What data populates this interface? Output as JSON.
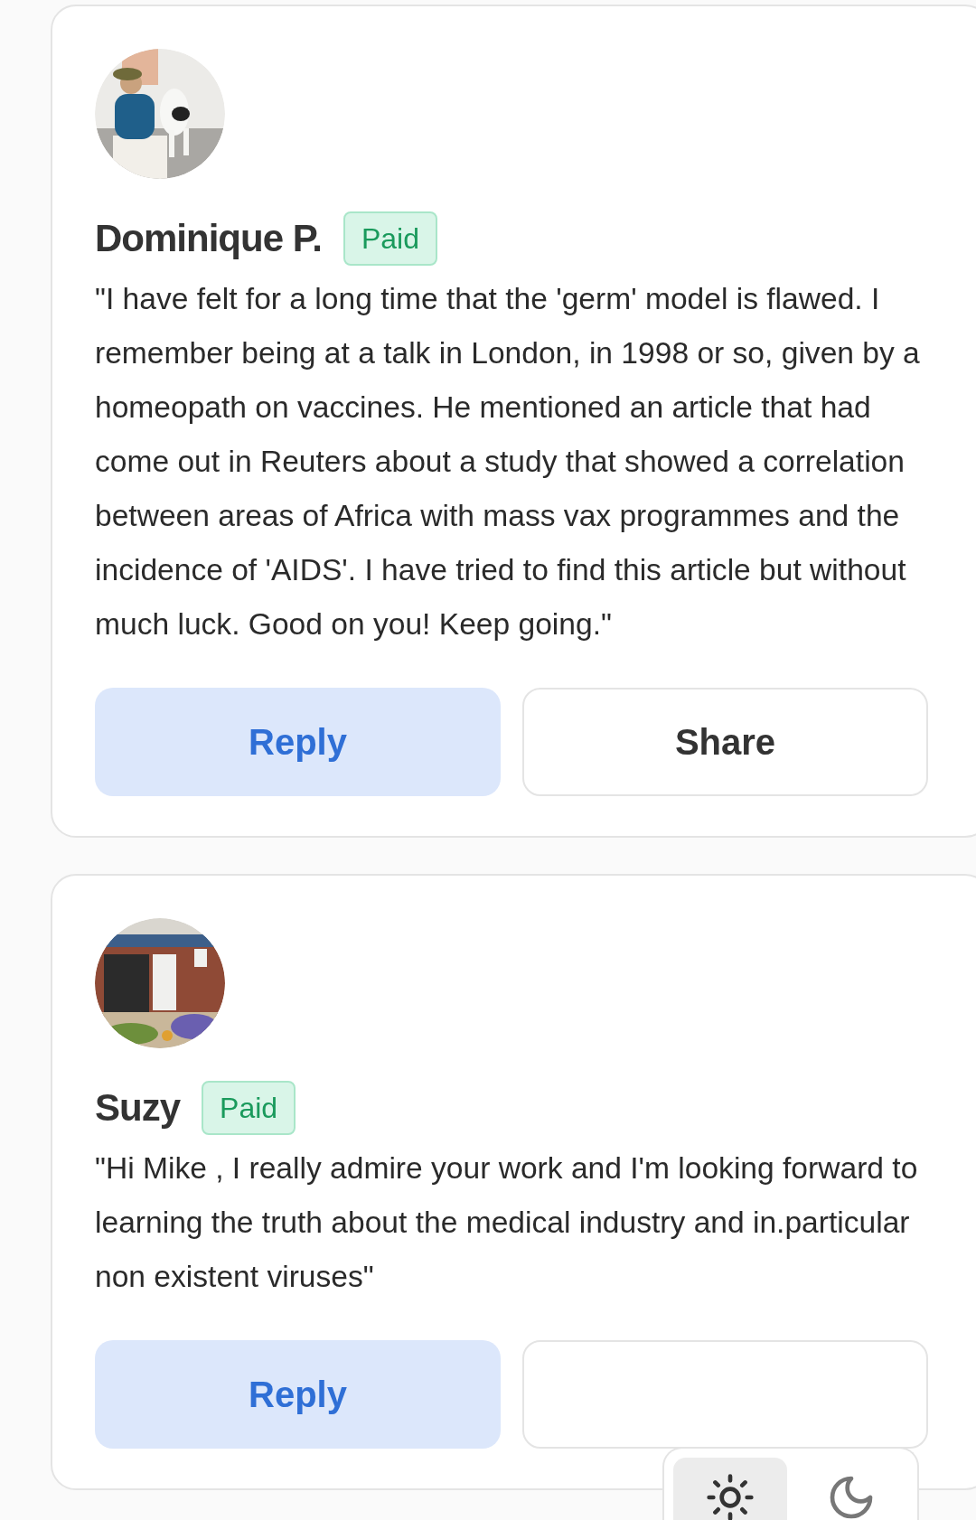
{
  "comments": [
    {
      "author": "Dominique P.",
      "badge": "Paid",
      "text": "\"I have felt for a long time that the 'germ' model is flawed. I remember being at a talk in London, in 1998 or so, given by a homeopath on vaccines. He mentioned an article that had come out in Reuters about a study that showed a correlation between areas of Africa with mass vax programmes and the incidence of 'AIDS'. I have tried to find this article but without much luck. Good on you! Keep going.\"",
      "buttons": [
        {
          "kind": "reply",
          "label": "Reply"
        },
        {
          "kind": "share",
          "label": "Share"
        }
      ]
    },
    {
      "author": "Suzy",
      "badge": "Paid",
      "text": "\"Hi Mike , I really admire your work and I'm looking forward to learning the truth about the medical industry and in.particular non existent viruses\"",
      "buttons": [
        {
          "kind": "reply",
          "label": "Reply"
        },
        {
          "kind": "share"
        }
      ]
    }
  ],
  "theme_switcher": [
    {
      "kind": "light",
      "selected": true
    },
    {
      "kind": "dark",
      "selected": false
    }
  ]
}
